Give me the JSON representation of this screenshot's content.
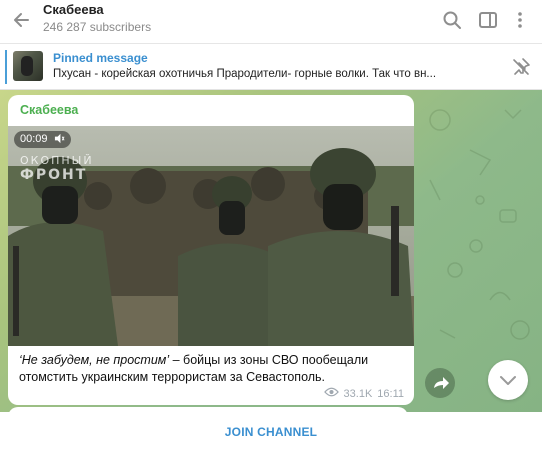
{
  "header": {
    "channel_name": "Скабеева",
    "subscribers": "246 287 subscribers",
    "icons": [
      "back-arrow-icon",
      "search-icon",
      "sidebar-panel-icon",
      "more-vertical-icon"
    ]
  },
  "pinned": {
    "title": "Pinned message",
    "text": "Пхусан - корейская охотничья   Прародители-  горные волки. Так что вн..."
  },
  "message": {
    "author": "Скабеева",
    "video_duration": "00:09",
    "watermark_line1": "ОКОПНЫЙ",
    "watermark_line2": "ФРОНТ",
    "caption_italic": "‘Не забудем, не простим’",
    "caption_rest": " – бойцы из зоны СВО пообещали отомстить украинским террористам за Севастополь.",
    "views": "33.1K",
    "time": "16:11"
  },
  "footer": {
    "join_label": "JOIN CHANNEL"
  },
  "colors": {
    "accent": "#3a8fd0",
    "author_green": "#4caf50",
    "chat_bg": "#a9c47e"
  }
}
